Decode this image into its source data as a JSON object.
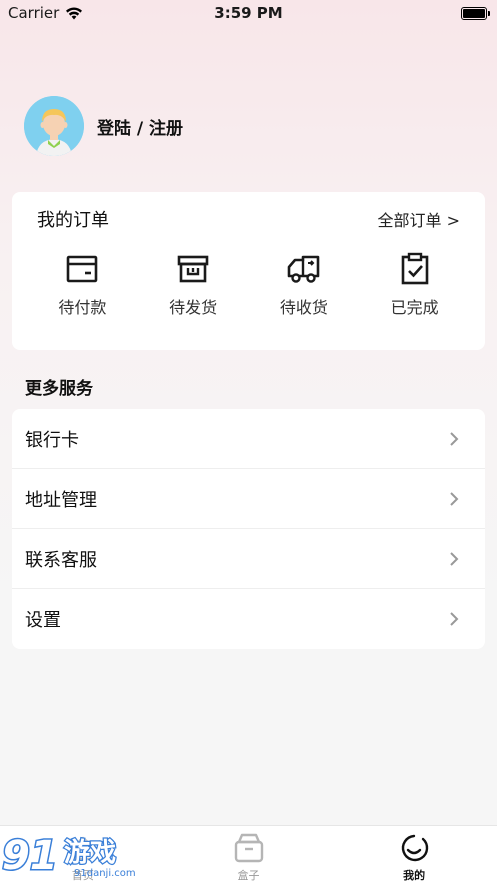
{
  "status_bar": {
    "carrier": "Carrier",
    "time": "3:59 PM"
  },
  "profile": {
    "login_label": "登陆 / 注册"
  },
  "orders": {
    "title": "我的订单",
    "all_link": "全部订单 >",
    "items": [
      {
        "label": "待付款",
        "icon": "wallet-icon"
      },
      {
        "label": "待发货",
        "icon": "box-icon"
      },
      {
        "label": "待收货",
        "icon": "truck-icon"
      },
      {
        "label": "已完成",
        "icon": "clipboard-check-icon"
      }
    ]
  },
  "services": {
    "title": "更多服务",
    "items": [
      {
        "label": "银行卡"
      },
      {
        "label": "地址管理"
      },
      {
        "label": "联系客服"
      },
      {
        "label": "设置"
      }
    ]
  },
  "tabbar": {
    "tabs": [
      {
        "label": "首页",
        "icon": "home-icon"
      },
      {
        "label": "盒子",
        "icon": "box-tab-icon"
      },
      {
        "label": "我的",
        "icon": "profile-smile-icon",
        "active": true
      }
    ]
  },
  "watermark": {
    "logo_text": "91游戏",
    "url": "91danji.com"
  },
  "colors": {
    "accent_text": "#111111",
    "avatar_bg": "#7fd0ef",
    "watermark_blue": "#3a7fd8"
  }
}
